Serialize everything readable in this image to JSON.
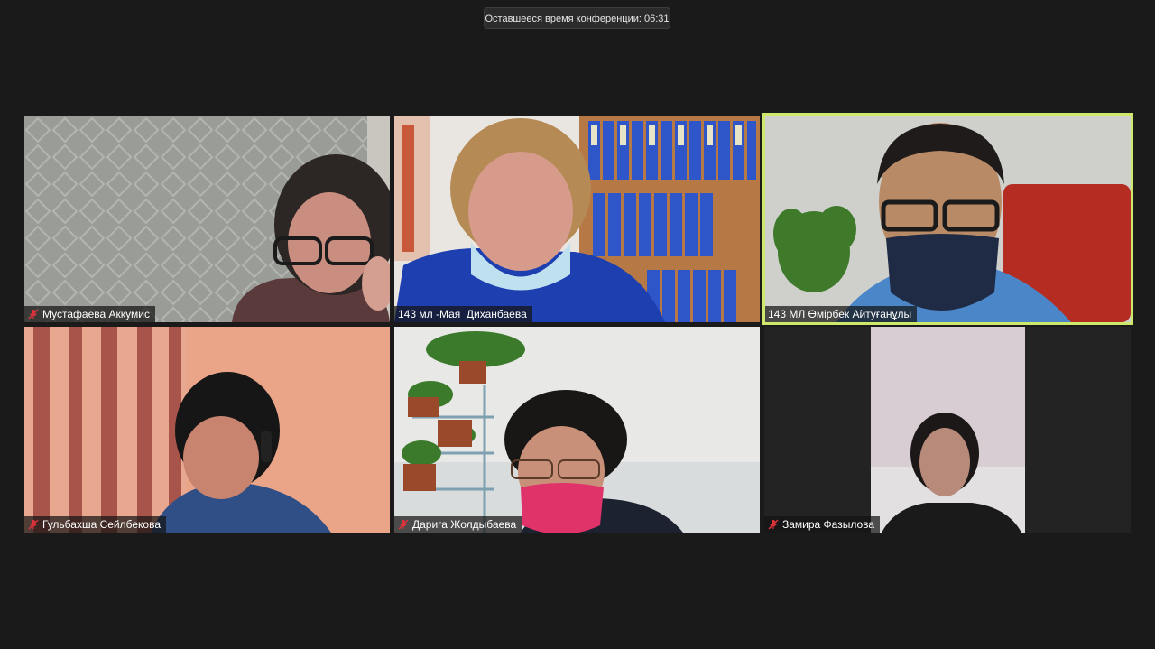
{
  "meeting": {
    "remaining_time_label": "Оставшееся время конференции: 06:31"
  },
  "participants": [
    {
      "name": "Мустафаева Аккумис",
      "muted": true
    },
    {
      "name": "143 мл -Мая  Диханбаева",
      "muted": false
    },
    {
      "name": "143 МЛ Өмірбек Айтуғанұлы",
      "muted": false,
      "active_speaker": true
    },
    {
      "name": "Гульбахша Сейлбекова",
      "muted": true
    },
    {
      "name": "Дарига Жолдыбаева",
      "muted": true
    },
    {
      "name": "Замира Фазылова",
      "muted": true
    }
  ],
  "colors": {
    "background": "#1a1a1a",
    "active_speaker_border": "#cde86a",
    "muted_icon": "#e0323c"
  }
}
